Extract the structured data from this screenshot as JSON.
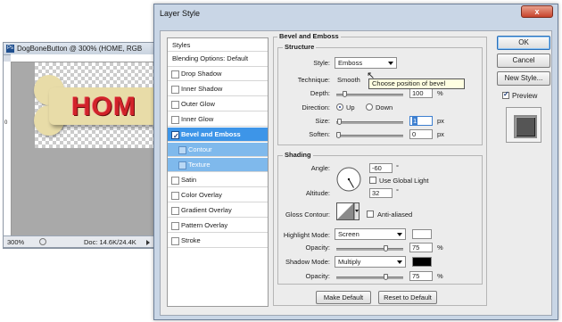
{
  "document": {
    "title": "DogBoneButton @ 300% (HOME, RGB",
    "ps_icon": "Ps",
    "ruler_v_mark": "0",
    "bone_text": "HOM",
    "zoom": "300%",
    "doc_size": "Doc: 14.6K/24.4K"
  },
  "dialog": {
    "title": "Layer Style",
    "close_label": "x"
  },
  "styles_list": {
    "header": "Styles",
    "blending": "Blending Options: Default",
    "items": [
      {
        "label": "Drop Shadow",
        "checked": false
      },
      {
        "label": "Inner Shadow",
        "checked": false
      },
      {
        "label": "Outer Glow",
        "checked": false
      },
      {
        "label": "Inner Glow",
        "checked": false
      },
      {
        "label": "Bevel and Emboss",
        "checked": true
      },
      {
        "label": "Contour",
        "checked": false
      },
      {
        "label": "Texture",
        "checked": false
      },
      {
        "label": "Satin",
        "checked": false
      },
      {
        "label": "Color Overlay",
        "checked": false
      },
      {
        "label": "Gradient Overlay",
        "checked": false
      },
      {
        "label": "Pattern Overlay",
        "checked": false
      },
      {
        "label": "Stroke",
        "checked": false
      }
    ]
  },
  "bevel": {
    "section_title": "Bevel and Emboss",
    "structure_title": "Structure",
    "style_label": "Style:",
    "style_value": "Emboss",
    "technique_label": "Technique:",
    "technique_value": "Smooth",
    "tooltip": "Choose position of bevel",
    "depth_label": "Depth:",
    "depth_value": "100",
    "depth_unit": "%",
    "direction_label": "Direction:",
    "dir_up": "Up",
    "dir_down": "Down",
    "size_label": "Size:",
    "size_value": "1",
    "size_unit": "px",
    "soften_label": "Soften:",
    "soften_value": "0",
    "soften_unit": "px"
  },
  "shading": {
    "title": "Shading",
    "angle_label": "Angle:",
    "angle_value": "-60",
    "angle_unit": "°",
    "global_light_label": "Use Global Light",
    "altitude_label": "Altitude:",
    "altitude_value": "32",
    "altitude_unit": "°",
    "gloss_label": "Gloss Contour:",
    "anti_aliased_label": "Anti-aliased",
    "highlight_mode_label": "Highlight Mode:",
    "highlight_mode_value": "Screen",
    "highlight_color": "#ffffff",
    "opacity1_label": "Opacity:",
    "opacity1_value": "75",
    "opacity1_unit": "%",
    "shadow_mode_label": "Shadow Mode:",
    "shadow_mode_value": "Multiply",
    "shadow_color": "#000000",
    "opacity2_label": "Opacity:",
    "opacity2_value": "75",
    "opacity2_unit": "%"
  },
  "footer": {
    "make_default": "Make Default",
    "reset_default": "Reset to Default"
  },
  "actions": {
    "ok": "OK",
    "cancel": "Cancel",
    "new_style": "New Style...",
    "preview": "Preview"
  },
  "levels": {
    "depth": 0.1,
    "size": 0.01,
    "soften": 0.0,
    "opacity1": 0.75,
    "opacity2": 0.75,
    "angle_deg": -60
  }
}
